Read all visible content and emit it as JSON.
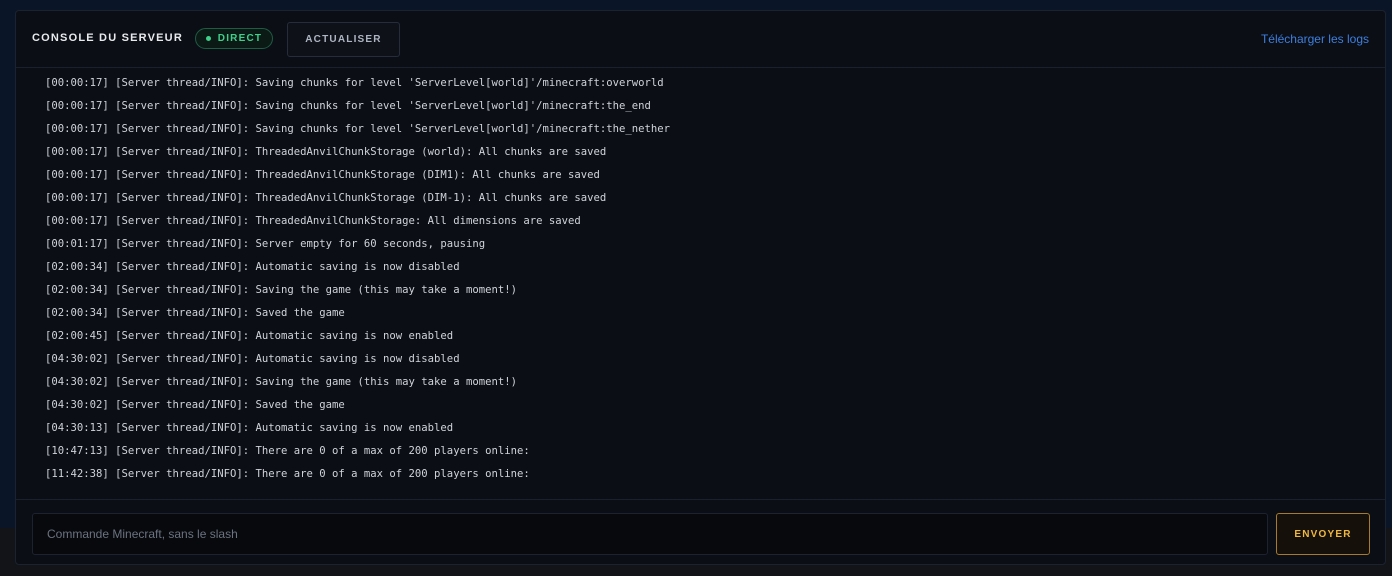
{
  "header": {
    "title": "CONSOLE DU SERVEUR",
    "live_label": "DIRECT",
    "refresh_label": "ACTUALISER",
    "download_label": "Télécharger les logs"
  },
  "logs": [
    "[00:00:17] [Server thread/INFO]: Saving chunks for level 'ServerLevel[world]'/minecraft:overworld",
    "[00:00:17] [Server thread/INFO]: Saving chunks for level 'ServerLevel[world]'/minecraft:the_end",
    "[00:00:17] [Server thread/INFO]: Saving chunks for level 'ServerLevel[world]'/minecraft:the_nether",
    "[00:00:17] [Server thread/INFO]: ThreadedAnvilChunkStorage (world): All chunks are saved",
    "[00:00:17] [Server thread/INFO]: ThreadedAnvilChunkStorage (DIM1): All chunks are saved",
    "[00:00:17] [Server thread/INFO]: ThreadedAnvilChunkStorage (DIM-1): All chunks are saved",
    "[00:00:17] [Server thread/INFO]: ThreadedAnvilChunkStorage: All dimensions are saved",
    "[00:01:17] [Server thread/INFO]: Server empty for 60 seconds, pausing",
    "[02:00:34] [Server thread/INFO]: Automatic saving is now disabled",
    "[02:00:34] [Server thread/INFO]: Saving the game (this may take a moment!)",
    "[02:00:34] [Server thread/INFO]: Saved the game",
    "[02:00:45] [Server thread/INFO]: Automatic saving is now enabled",
    "[04:30:02] [Server thread/INFO]: Automatic saving is now disabled",
    "[04:30:02] [Server thread/INFO]: Saving the game (this may take a moment!)",
    "[04:30:02] [Server thread/INFO]: Saved the game",
    "[04:30:13] [Server thread/INFO]: Automatic saving is now enabled",
    "[10:47:13] [Server thread/INFO]: There are 0 of a max of 200 players online:",
    "[11:42:38] [Server thread/INFO]: There are 0 of a max of 200 players online:"
  ],
  "command": {
    "placeholder": "Commande Minecraft, sans le slash",
    "value": "",
    "send_label": "ENVOYER"
  },
  "colors": {
    "live": "#3fd08a",
    "link": "#3d7fe0",
    "send_accent": "#f0b840"
  }
}
